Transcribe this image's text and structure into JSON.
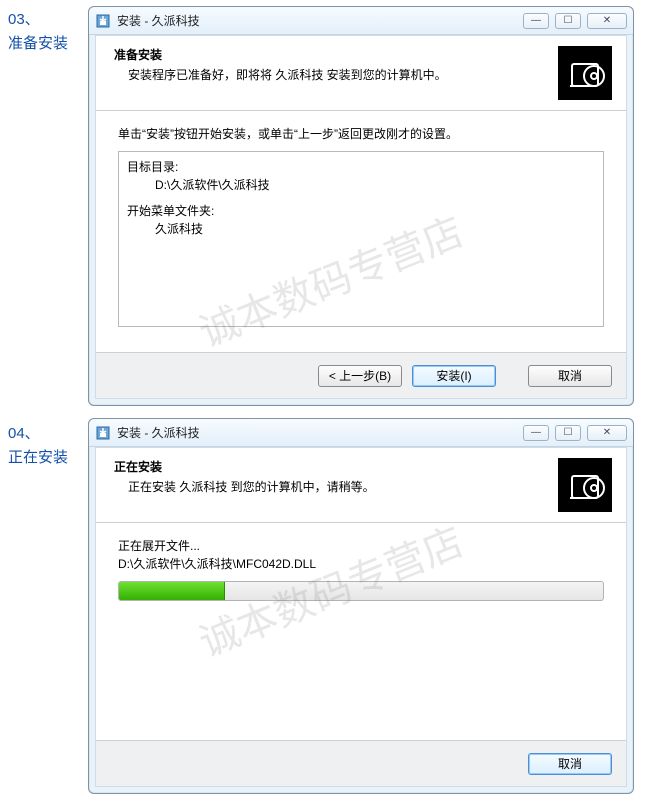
{
  "steps": {
    "s03": {
      "num": "03、",
      "label": "准备安装"
    },
    "s04": {
      "num": "04、",
      "label": "正在安装"
    }
  },
  "watermark": "诚本数码专营店",
  "win1": {
    "title": "安装 - 久派科技",
    "header_title": "准备安装",
    "header_sub": "安装程序已准备好，即将将 久派科技 安装到您的计算机中。",
    "instruction": "单击“安装”按钮开始安装，或单击“上一步”返回更改刚才的设置。",
    "target_label": "目标目录:",
    "target_value": "D:\\久派软件\\久派科技",
    "menu_label": "开始菜单文件夹:",
    "menu_value": "久派科技",
    "btn_back": "< 上一步(B)",
    "btn_install": "安装(I)",
    "btn_cancel": "取消"
  },
  "win2": {
    "title": "安装 - 久派科技",
    "header_title": "正在安装",
    "header_sub": "正在安装 久派科技 到您的计算机中，请稍等。",
    "extract_label": "正在展开文件...",
    "extract_path": "D:\\久派软件\\久派科技\\MFC042D.DLL",
    "progress_percent": 22,
    "btn_cancel": "取消"
  }
}
